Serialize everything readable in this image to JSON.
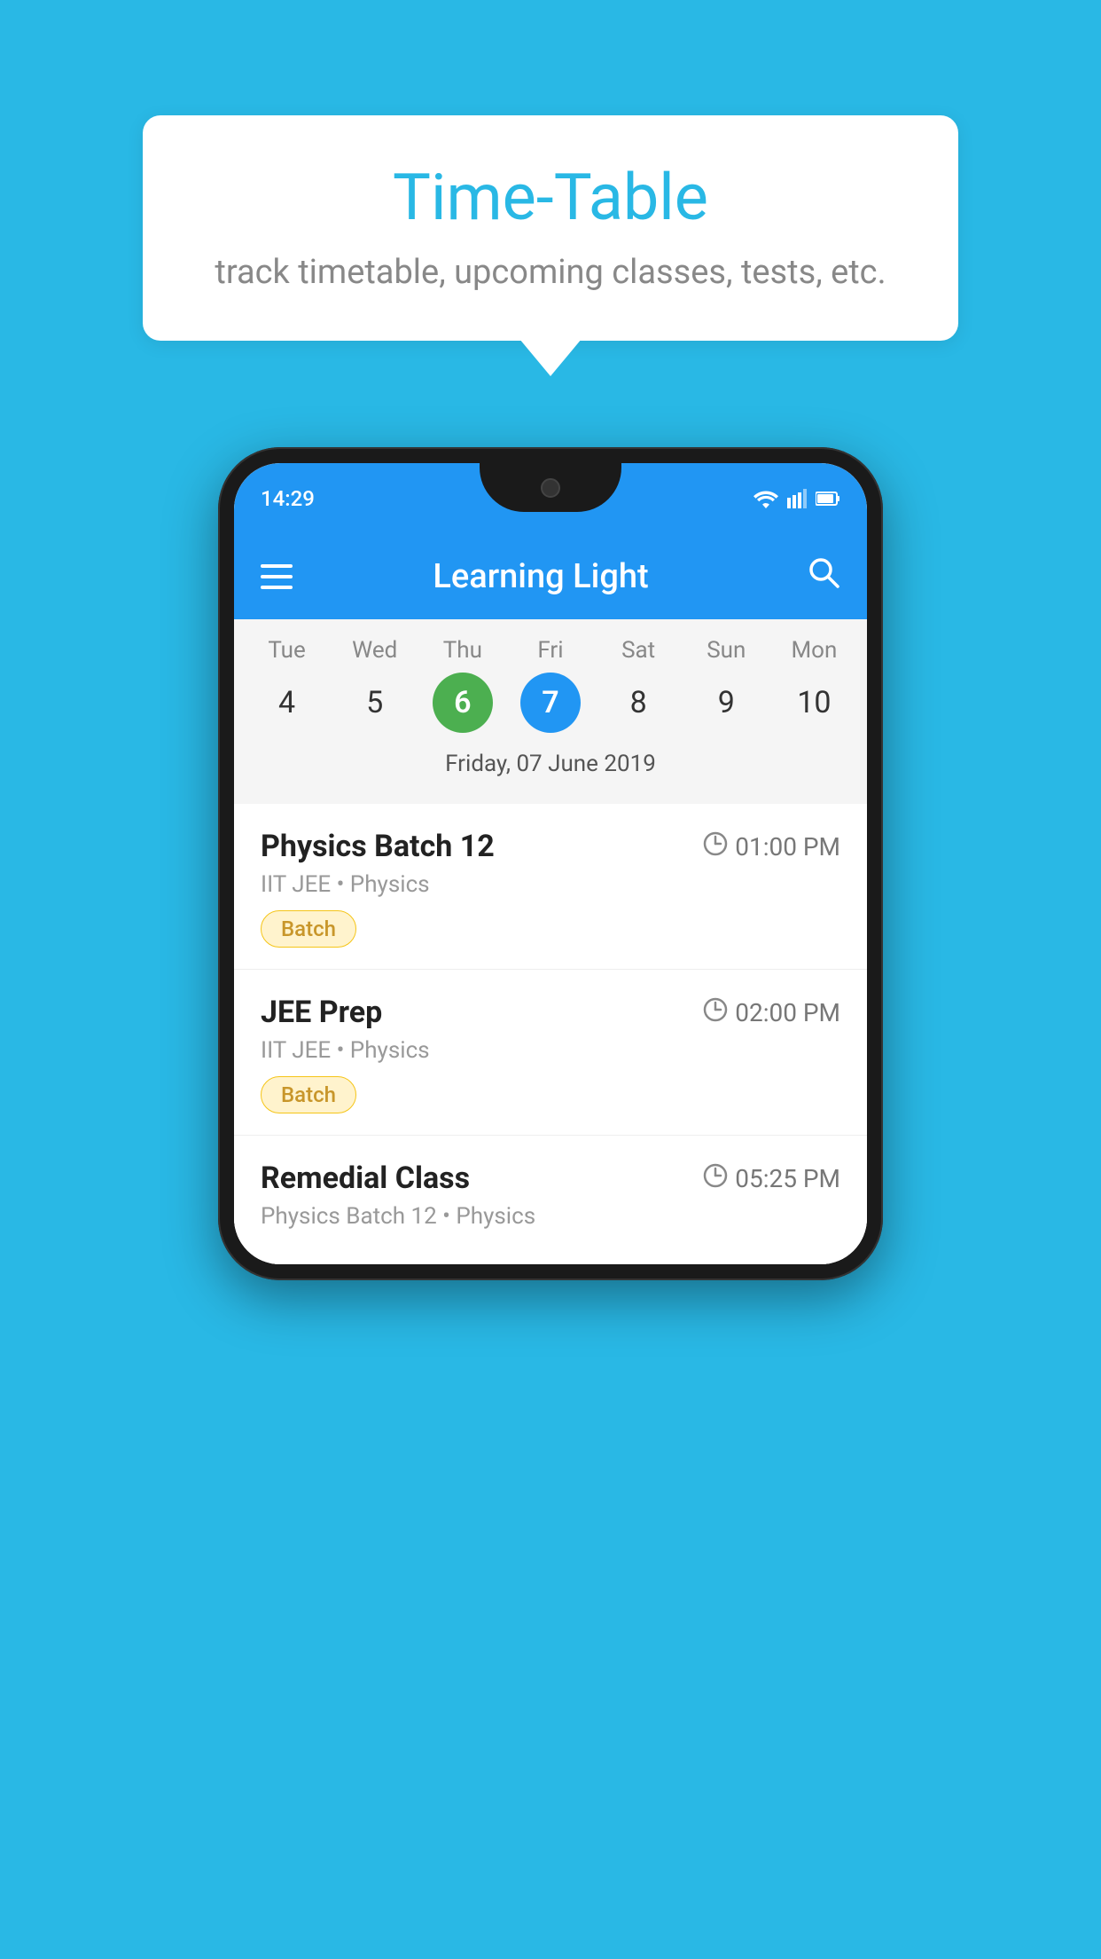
{
  "background_color": "#29B8E5",
  "speech_bubble": {
    "title": "Time-Table",
    "subtitle": "track timetable, upcoming classes, tests, etc."
  },
  "phone": {
    "status_bar": {
      "time": "14:29"
    },
    "app_bar": {
      "title": "Learning Light"
    },
    "calendar": {
      "days": [
        {
          "name": "Tue",
          "number": "4",
          "state": "normal"
        },
        {
          "name": "Wed",
          "number": "5",
          "state": "normal"
        },
        {
          "name": "Thu",
          "number": "6",
          "state": "today"
        },
        {
          "name": "Fri",
          "number": "7",
          "state": "selected"
        },
        {
          "name": "Sat",
          "number": "8",
          "state": "normal"
        },
        {
          "name": "Sun",
          "number": "9",
          "state": "normal"
        },
        {
          "name": "Mon",
          "number": "10",
          "state": "normal"
        }
      ],
      "selected_date_label": "Friday, 07 June 2019"
    },
    "schedule": [
      {
        "title": "Physics Batch 12",
        "time": "01:00 PM",
        "meta": "IIT JEE • Physics",
        "badge": "Batch"
      },
      {
        "title": "JEE Prep",
        "time": "02:00 PM",
        "meta": "IIT JEE • Physics",
        "badge": "Batch"
      },
      {
        "title": "Remedial Class",
        "time": "05:25 PM",
        "meta": "Physics Batch 12 • Physics",
        "badge": null
      }
    ]
  }
}
